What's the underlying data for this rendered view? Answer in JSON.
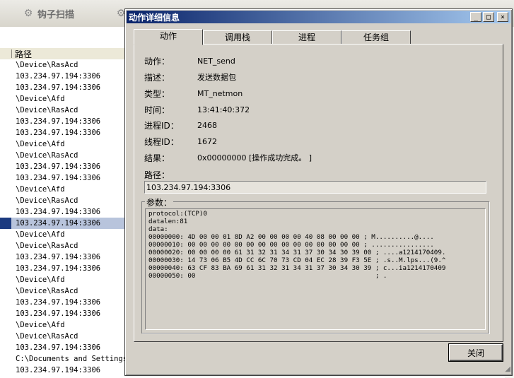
{
  "background_app": {
    "toolbar": {
      "hook_scan_label": "钩子扫描",
      "hook_scan_icon": "gear-icon",
      "second_tool_icon": "gear-icon"
    },
    "list_header": {
      "path_column": "路径"
    },
    "rows": [
      "\\Device\\RasAcd",
      "103.234.97.194:3306",
      "103.234.97.194:3306",
      "\\Device\\Afd",
      "\\Device\\RasAcd",
      "103.234.97.194:3306",
      "103.234.97.194:3306",
      "\\Device\\Afd",
      "\\Device\\RasAcd",
      "103.234.97.194:3306",
      "103.234.97.194:3306",
      "\\Device\\Afd",
      "\\Device\\RasAcd",
      "103.234.97.194:3306",
      "103.234.97.194:3306",
      "\\Device\\Afd",
      "\\Device\\RasAcd",
      "103.234.97.194:3306",
      "103.234.97.194:3306",
      "\\Device\\Afd",
      "\\Device\\RasAcd",
      "103.234.97.194:3306",
      "103.234.97.194:3306",
      "\\Device\\Afd",
      "\\Device\\RasAcd",
      "103.234.97.194:3306",
      "C:\\Documents and Settings\\",
      "103.234.97.194:3306"
    ],
    "selected_row_index": 14
  },
  "dialog": {
    "title": "动作详细信息",
    "window_buttons": {
      "minimize": "_",
      "maximize": "□",
      "close": "×"
    },
    "tabs": [
      "动作",
      "调用栈",
      "进程",
      "任务组"
    ],
    "active_tab": 0,
    "fields": [
      {
        "label": "动作：",
        "value": "NET_send"
      },
      {
        "label": "描述：",
        "value": "发送数据包"
      },
      {
        "label": "类型：",
        "value": "MT_netmon"
      },
      {
        "label": "时间：",
        "value": "13:41:40:372"
      },
      {
        "label": "进程ID：",
        "value": "2468"
      },
      {
        "label": "线程ID：",
        "value": "1672"
      },
      {
        "label": "结果：",
        "value": "0x00000000 [操作成功完成。 ]"
      }
    ],
    "path_label": "路径：",
    "path_value": "103.234.97.194:3306",
    "params_label": "参数：",
    "params_lines": [
      "protocol:(TCP)0",
      "datalen:81",
      "data:",
      "00000000: 4D 00 00 01 8D A2 00 00 00 00 40 08 00 00 00 ; M..........@....",
      "00000010: 00 00 00 00 00 00 00 00 00 00 00 00 00 00 00 ; ................",
      "00000020: 00 00 00 00 61 31 32 31 34 31 37 30 34 30 39 00 ; ....a1214170409.",
      "00000030: 14 73 06 B5 4D CC 6C 70 73 CD 04 EC 28 39 F3 5E ; .s..M.lps...(9.^",
      "00000040: 63 CF 83 BA 69 61 31 32 31 34 31 37 30 34 30 39 ; c...ia1214170409",
      "00000050: 00                                              ; ."
    ],
    "close_button": "关闭"
  }
}
